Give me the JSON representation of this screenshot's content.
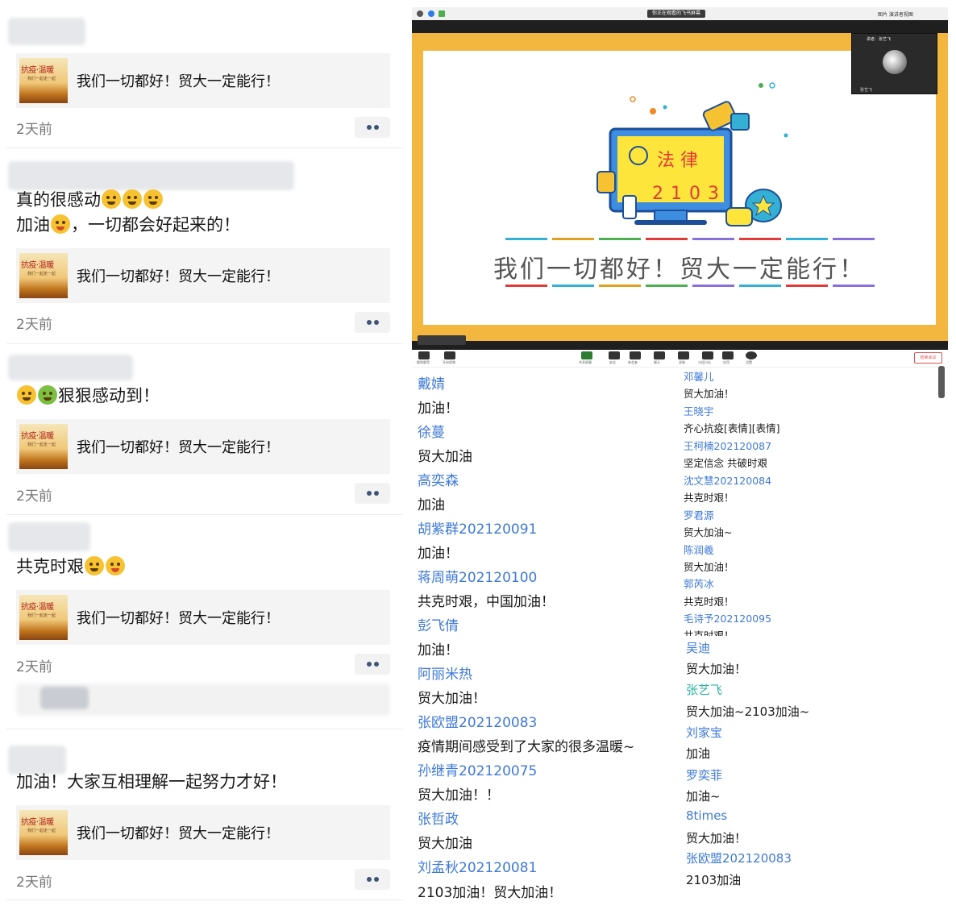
{
  "feed": {
    "card_text": "我们一切都好！贸大一定能行！",
    "thumb_title": "抗疫·温暖",
    "thumb_sub": "我们一起走一起",
    "time": "2天前",
    "posts": [
      {
        "line1": "",
        "line2": ""
      },
      {
        "line1": "真的很感动",
        "line2a": "加油",
        "line2b": "，一切都会好起来的！"
      },
      {
        "line1": "狠狠感动到！"
      },
      {
        "line1": "共克时艰"
      },
      {
        "line1": ""
      },
      {
        "line1": "加油！大家互相理解一起努力才好！"
      }
    ]
  },
  "meeting": {
    "title": "你正在观看的飞书屏幕",
    "right_text": "图片 演讲者视图",
    "slide": {
      "heading": "法  律",
      "class_no": "2103",
      "slogan": "我们一切都好！贸大一定能行！"
    },
    "video_name": "讲者：张艺飞",
    "mic_label": "张艺飞",
    "end_button": "结束会议"
  },
  "toolbar": {
    "labels": [
      "解除静音",
      "开启视频",
      "安全",
      "参会者",
      "聊天",
      "共享屏幕",
      "录制",
      "分组讨论",
      "应用",
      "设置"
    ]
  },
  "chat_left": [
    {
      "name": "戴婧",
      "msg": "加油！"
    },
    {
      "name": "徐蔓",
      "msg": "贸大加油"
    },
    {
      "name": "高奕森",
      "msg": "加油"
    },
    {
      "name": "胡紫群202120091",
      "msg": "加油！"
    },
    {
      "name": "蒋周萌202120100",
      "msg": "共克时艰，中国加油！"
    },
    {
      "name": "彭飞倩",
      "msg": "加油！"
    },
    {
      "name": "阿丽米热",
      "msg": "贸大加油！"
    },
    {
      "name": "张欧盟202120083",
      "msg": "疫情期间感受到了大家的很多温暖~"
    },
    {
      "name": "孙继青202120075",
      "msg": "贸大加油！！"
    },
    {
      "name": "张哲政",
      "msg": "贸大加油"
    },
    {
      "name": "刘孟秋202120081",
      "msg": "2103加油！贸大加油！"
    }
  ],
  "chat_right_small": [
    {
      "name": "邓馨儿",
      "msg": "贸大加油！"
    },
    {
      "name": "王晓宇",
      "msg": "齐心抗疫[表情][表情]"
    },
    {
      "name": "王柯楠202120087",
      "msg": "坚定信念 共破时艰"
    },
    {
      "name": "沈文慧202120084",
      "msg": "共克时艰！"
    },
    {
      "name": "罗君源",
      "msg": "贸大加油~"
    },
    {
      "name": "陈润羲",
      "msg": "贸大加油！"
    },
    {
      "name": "郭芮冰",
      "msg": "共克时艰！"
    },
    {
      "name": "毛诗予202120095",
      "msg": "共克时艰！"
    }
  ],
  "chat_right_large": [
    {
      "name": "吴迪",
      "msg": "贸大加油！",
      "teal": false
    },
    {
      "name": "张艺飞",
      "msg": "贸大加油~2103加油~",
      "teal": true
    },
    {
      "name": "刘家宝",
      "msg": "加油",
      "teal": false
    },
    {
      "name": "罗奕菲",
      "msg": "加油~",
      "teal": false
    },
    {
      "name": "8times",
      "msg": "贸大加油！",
      "teal": false
    },
    {
      "name": "张欧盟202120083",
      "msg": "2103加油",
      "teal": false
    }
  ]
}
